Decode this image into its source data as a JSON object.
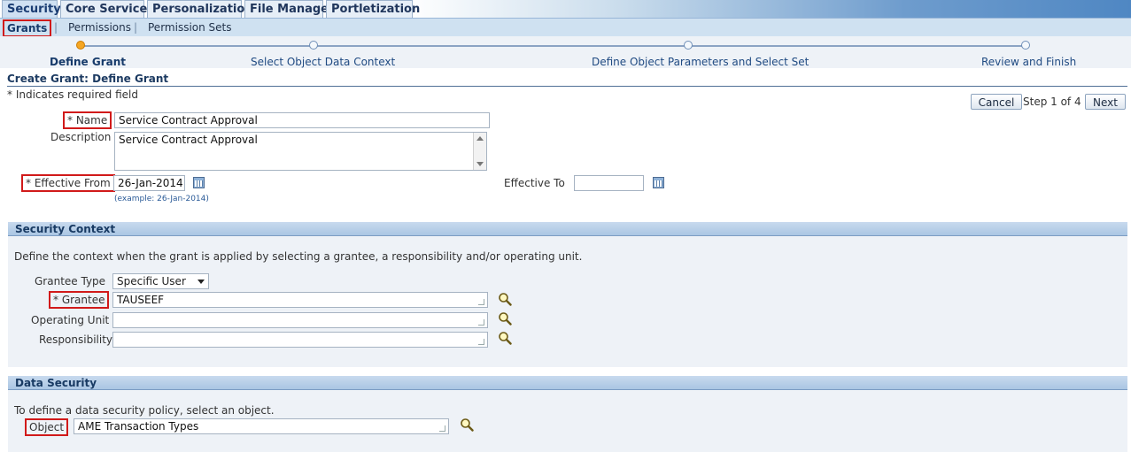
{
  "tabs": [
    "Security",
    "Core Services",
    "Personalization",
    "File Manager",
    "Portletization"
  ],
  "subnav": [
    "Grants",
    "Permissions",
    "Permission Sets"
  ],
  "train": [
    "Define Grant",
    "Select Object Data Context",
    "Define Object Parameters and Select Set",
    "Review and Finish"
  ],
  "page": {
    "title": "Create Grant: Define Grant",
    "required_note": "* Indicates required field",
    "cancel": "Cancel",
    "step": "Step 1 of 4",
    "next": "Next"
  },
  "form": {
    "name_label": "* Name",
    "name_value": "Service Contract Approval",
    "description_label": "Description",
    "description_value": "Service Contract Approval",
    "effective_from_label": "* Effective From",
    "effective_from_value": "26-Jan-2014",
    "date_hint": "(example: 26-Jan-2014)",
    "effective_to_label": "Effective To",
    "effective_to_value": ""
  },
  "security_context": {
    "header": "Security Context",
    "description": "Define the context when the grant is applied by selecting a grantee, a responsibility and/or operating unit.",
    "grantee_type_label": "Grantee Type",
    "grantee_type_value": "Specific User",
    "grantee_label": "* Grantee",
    "grantee_value": "TAUSEEF",
    "operating_unit_label": "Operating Unit",
    "operating_unit_value": "",
    "responsibility_label": "Responsibility",
    "responsibility_value": ""
  },
  "data_security": {
    "header": "Data Security",
    "description": "To define a data security policy, select an object.",
    "object_label": "Object",
    "object_value": "AME Transaction Types"
  },
  "colors": {
    "accent": "#1d3b62",
    "highlight_box": "#d11a1a",
    "current_step": "#f5a623"
  }
}
